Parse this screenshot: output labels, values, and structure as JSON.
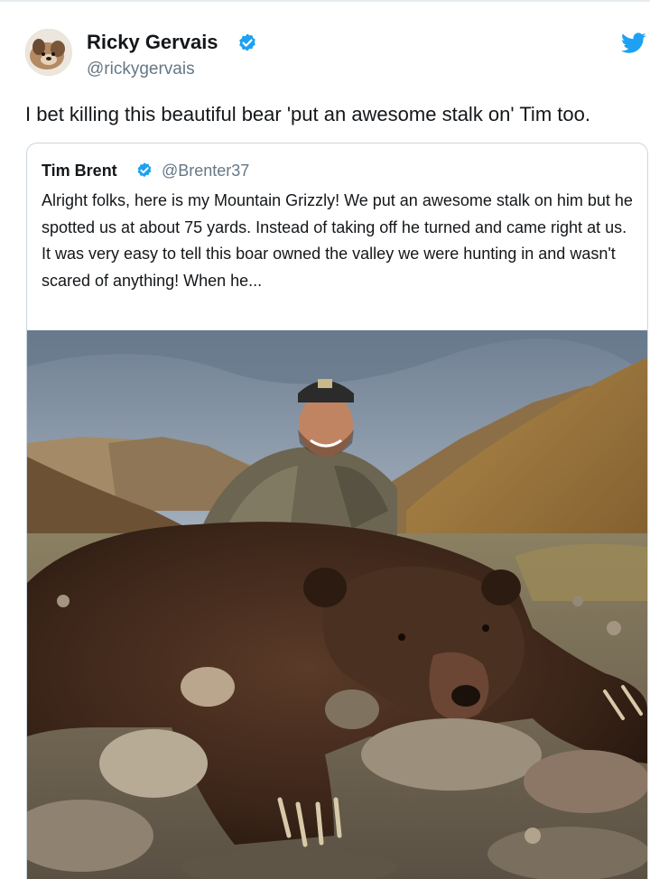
{
  "tweet": {
    "author_name": "Ricky Gervais",
    "author_handle": "@rickygervais",
    "text": "I bet killing this beautiful bear 'put an awesome stalk on' Tim too.",
    "verified_icon": "verified-badge-icon",
    "brand_icon": "twitter-bird-icon"
  },
  "quoted_tweet": {
    "author_name": "Tim Brent",
    "author_handle": "@Brenter37",
    "text": "Alright folks, here is my Mountain Grizzly! We put an awesome stalk on him but he spotted us at about 75 yards. Instead of taking off he turned and came right at us. It was very easy to tell this boar owned the valley we were hunting in and wasn't scared of anything! When he...",
    "verified_icon": "verified-badge-icon"
  },
  "colors": {
    "brand_blue": "#1da1f2",
    "text_primary": "#14171a",
    "text_secondary": "#657786",
    "border": "#ccd6dd"
  }
}
